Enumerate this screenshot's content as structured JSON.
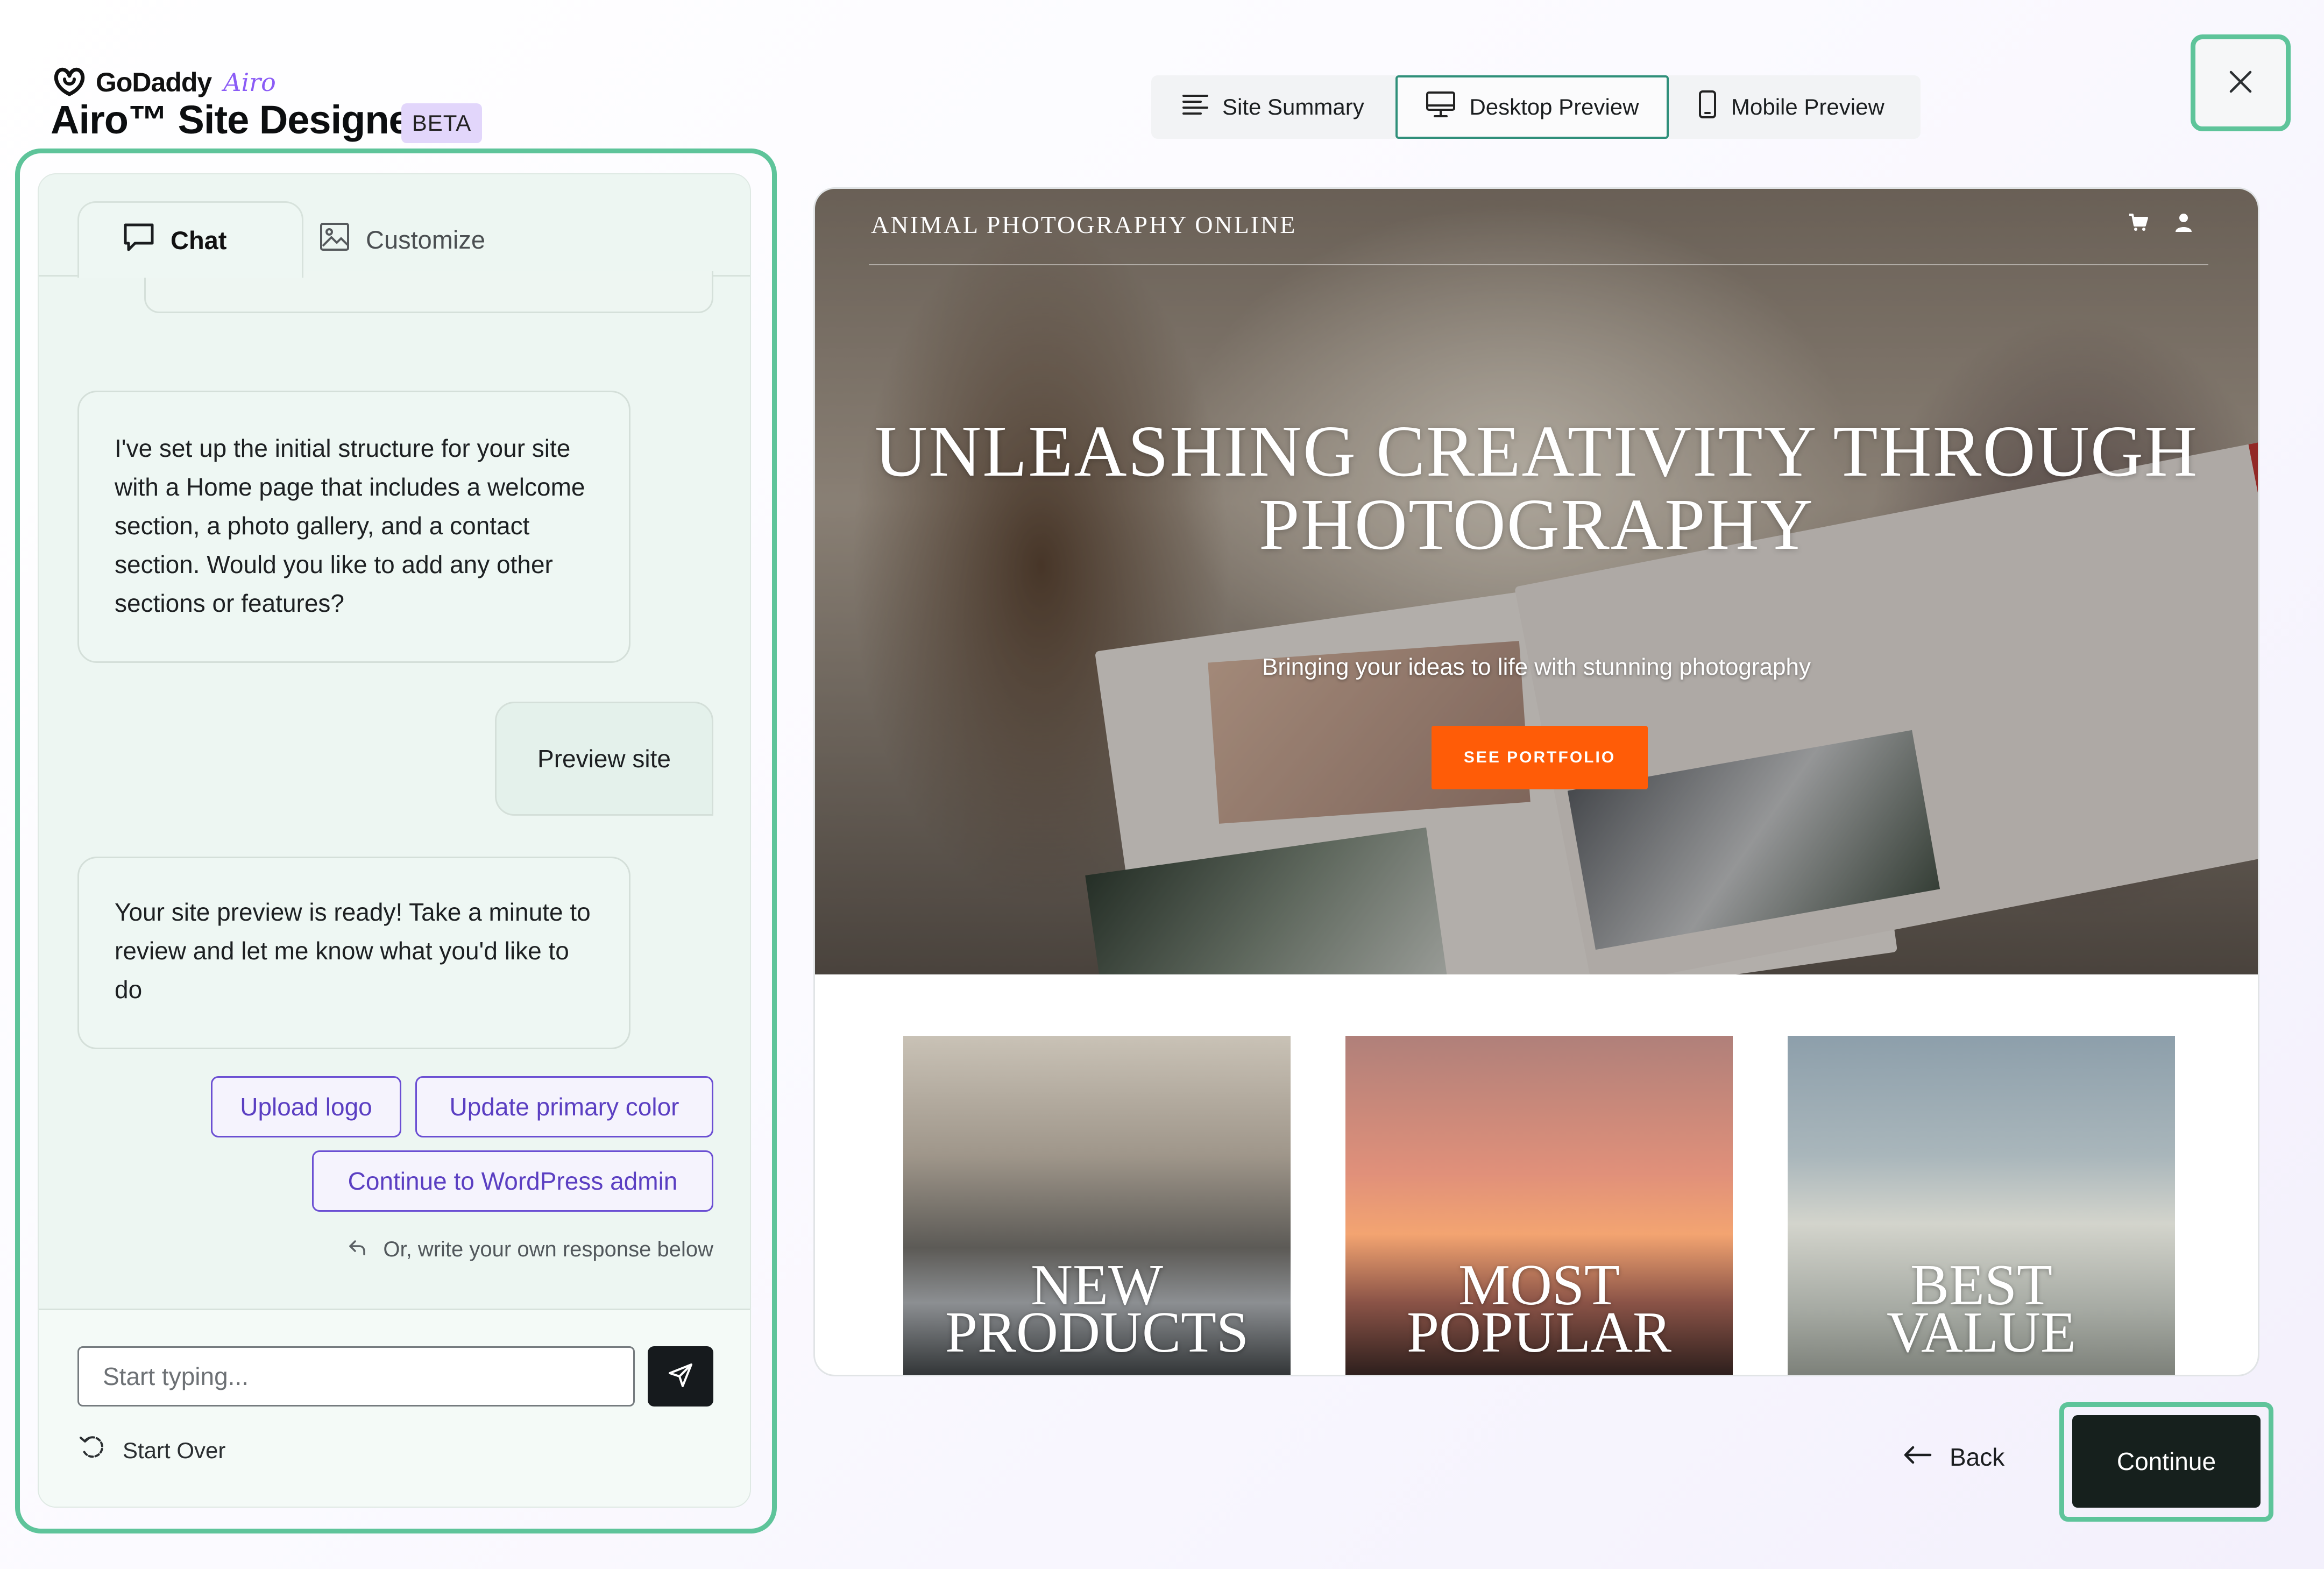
{
  "brand": {
    "godaddy": "GoDaddy",
    "airo": "Airo",
    "app_title": "Airo™ Site Designer",
    "badge": "BETA"
  },
  "view_tabs": [
    {
      "label": "Site Summary",
      "icon": "list-icon",
      "selected": false
    },
    {
      "label": "Desktop Preview",
      "icon": "monitor-icon",
      "selected": true
    },
    {
      "label": "Mobile Preview",
      "icon": "phone-icon",
      "selected": false
    }
  ],
  "chat_panel": {
    "tabs": [
      {
        "label": "Chat",
        "icon": "chat-bubble-icon",
        "selected": true
      },
      {
        "label": "Customize",
        "icon": "image-icon",
        "selected": false
      }
    ],
    "messages": [
      {
        "role": "assistant",
        "text": "I've set up the initial structure for your site with a Home page that includes a welcome section, a photo gallery, and a contact section. Would you like to add any other sections or features?"
      },
      {
        "role": "user",
        "text": "Preview site"
      },
      {
        "role": "assistant",
        "text": "Your site preview is ready! Take a minute to review and let me know what you'd like to do"
      }
    ],
    "suggestions": [
      "Upload logo",
      "Update primary color",
      "Continue to WordPress admin"
    ],
    "hint": "Or, write your own response below",
    "input_placeholder": "Start typing...",
    "start_over": "Start Over"
  },
  "preview": {
    "site_name": "ANIMAL PHOTOGRAPHY ONLINE",
    "hero_title": "UNLEASHING CREATIVITY THROUGH PHOTOGRAPHY",
    "hero_subtitle": "Bringing your ideas to life with stunning photography",
    "hero_button": "SEE PORTFOLIO",
    "cards": [
      {
        "label": "NEW\nPRODUCTS"
      },
      {
        "label": "MOST\nPOPULAR"
      },
      {
        "label": "BEST\nVALUE"
      }
    ]
  },
  "actions": {
    "back": "Back",
    "continue": "Continue"
  },
  "colors": {
    "accent_green": "#5ec49a",
    "chip_purple": "#6b4fd3",
    "hero_button": "#ff5c07",
    "continue_bg": "#16201d"
  }
}
